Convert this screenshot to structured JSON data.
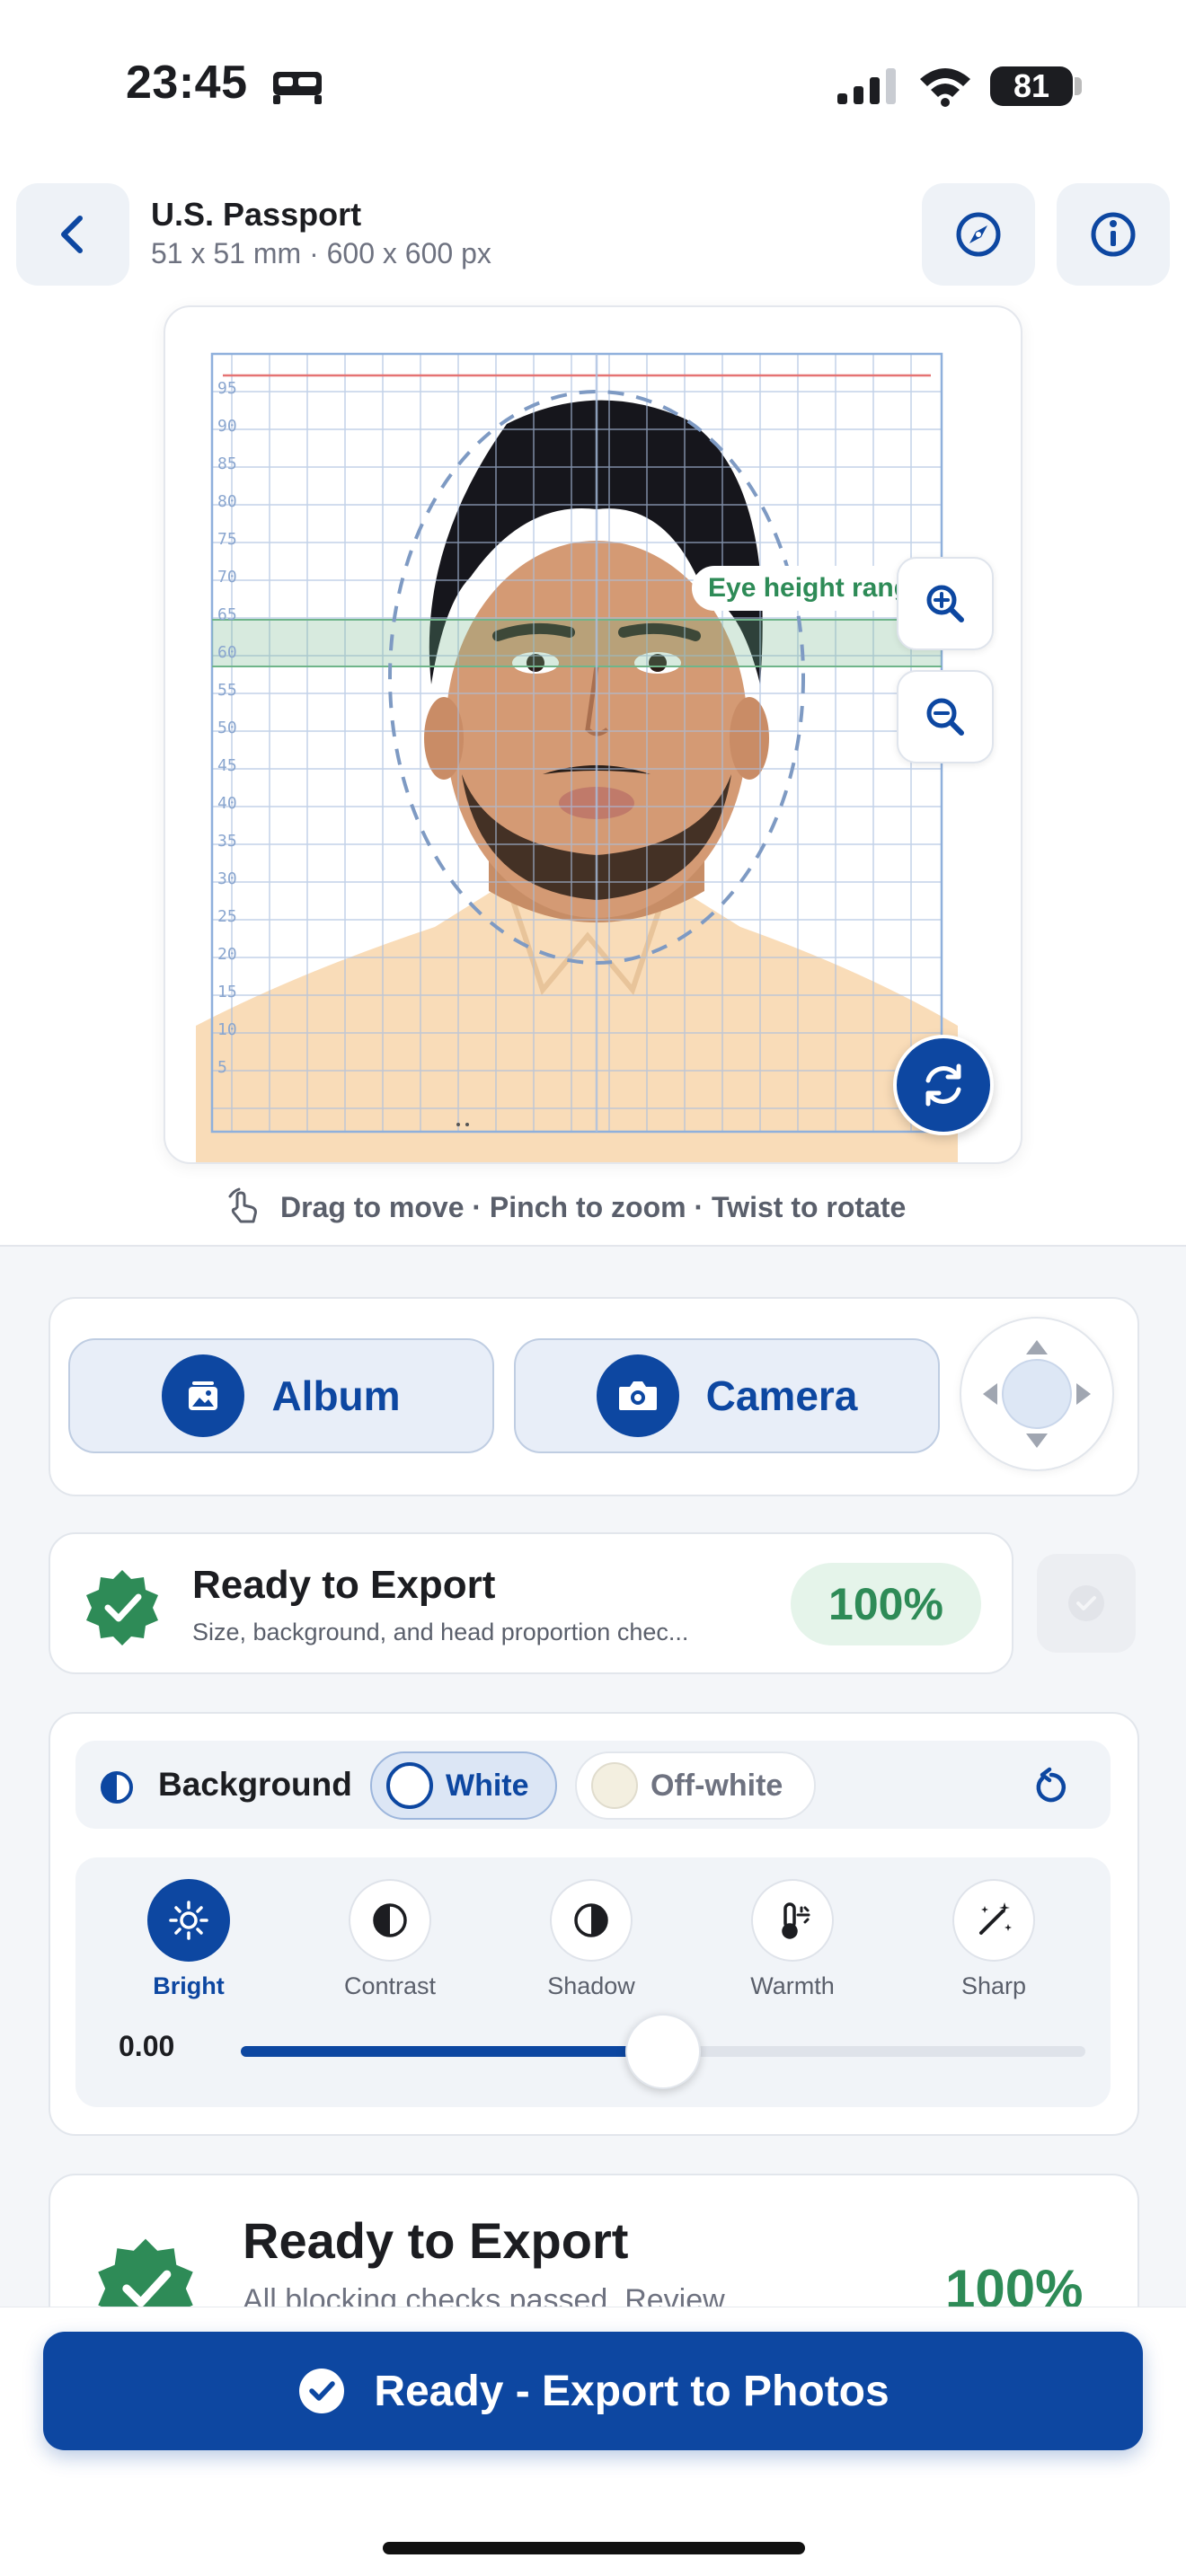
{
  "status_bar": {
    "time": "23:45",
    "battery": "81"
  },
  "header": {
    "title": "U.S. Passport",
    "subtitle": "51 x 51 mm · 600 x 600 px"
  },
  "photo": {
    "eye_label": "Eye height range",
    "ruler_ticks": [
      "95",
      "90",
      "85",
      "80",
      "75",
      "70",
      "65",
      "60",
      "55",
      "50",
      "45",
      "40",
      "35",
      "30",
      "25",
      "20",
      "15",
      "10",
      "5"
    ],
    "eye_band_percent": [
      60,
      65
    ]
  },
  "gesture_hint": "Drag to move · Pinch to zoom · Twist to rotate",
  "source": {
    "album_label": "Album",
    "camera_label": "Camera"
  },
  "export_status": {
    "title": "Ready to Export",
    "subtitle": "Size, background, and head proportion chec...",
    "percent": "100%"
  },
  "background": {
    "label": "Background",
    "options": [
      "White",
      "Off-white"
    ],
    "selected": "White"
  },
  "tools": {
    "items": [
      "Bright",
      "Contrast",
      "Shadow",
      "Warmth",
      "Sharp"
    ],
    "active": "Bright",
    "value": "0.00",
    "slider_fraction": 0.5
  },
  "summary": {
    "title": "Ready to Export",
    "subtitle": "All blocking checks passed. Review",
    "percent": "100%"
  },
  "cta": {
    "label": "Ready - Export to Photos"
  },
  "colors": {
    "primary": "#0d47a1",
    "success": "#2e8b57",
    "success_bg": "#e5f4ea"
  },
  "icons": [
    "bed-icon",
    "signal-icon",
    "wifi-icon",
    "back-chevron-icon",
    "compass-icon",
    "info-icon",
    "zoom-in-icon",
    "zoom-out-icon",
    "rotate-icon",
    "hand-gesture-icon",
    "album-icon",
    "camera-icon",
    "dpad-icon",
    "verified-badge-icon",
    "contrast-half-icon",
    "reset-icon",
    "brightness-icon",
    "shadow-icon",
    "thermometer-icon",
    "magic-wand-icon",
    "checkmark-icon"
  ]
}
